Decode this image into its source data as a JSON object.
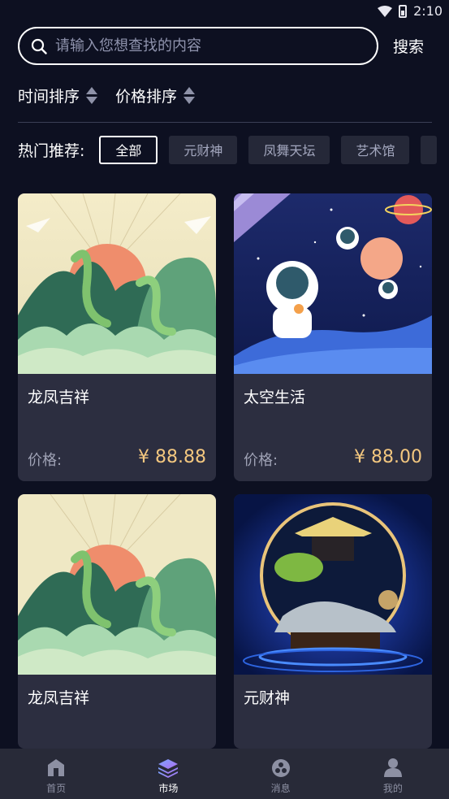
{
  "status_bar": {
    "time": "2:10"
  },
  "search": {
    "placeholder": "请输入您想查找的内容",
    "value": "",
    "button_label": "搜索"
  },
  "sort": {
    "time_label": "时间排序",
    "price_label": "价格排序"
  },
  "hot": {
    "label": "热门推荐:",
    "chips": [
      {
        "label": "全部",
        "active": true
      },
      {
        "label": "元财神",
        "active": false
      },
      {
        "label": "凤舞天坛",
        "active": false
      },
      {
        "label": "艺术馆",
        "active": false
      }
    ]
  },
  "products": [
    {
      "title": "龙凤吉祥",
      "price_label": "价格:",
      "price": "¥ 88.88",
      "image": "dragon-phoenix-artwork"
    },
    {
      "title": "太空生活",
      "price_label": "价格:",
      "price": "¥ 88.00",
      "image": "astronaut-space-artwork"
    },
    {
      "title": "龙凤吉祥",
      "price_label": "",
      "price": "",
      "image": "dragon-phoenix-artwork"
    },
    {
      "title": "元财神",
      "price_label": "",
      "price": "",
      "image": "golden-pavilion-artwork"
    }
  ],
  "tabbar": {
    "items": [
      {
        "label": "首页",
        "icon": "home-icon",
        "active": false
      },
      {
        "label": "市场",
        "icon": "layers-icon",
        "active": true
      },
      {
        "label": "消息",
        "icon": "message-icon",
        "active": false
      },
      {
        "label": "我的",
        "icon": "user-icon",
        "active": false
      }
    ]
  },
  "colors": {
    "background": "#0d1021",
    "card": "#2c2e40",
    "price": "#f3c77f",
    "tabbar": "#282a38"
  }
}
